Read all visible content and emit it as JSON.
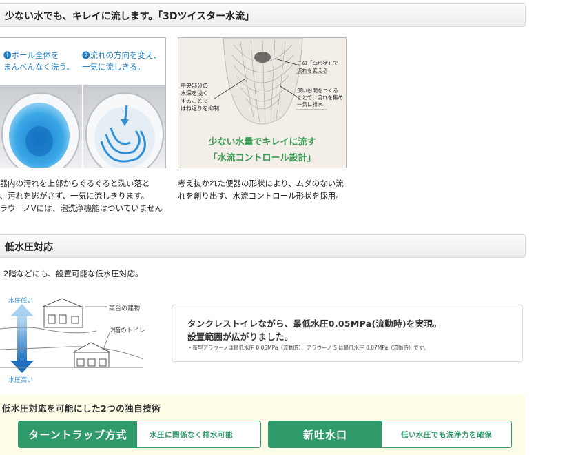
{
  "section1": {
    "header": "少ない水でも、キレイに流します。「3Dツイスター水流」",
    "photo1": {
      "step1": "❶ボール全体を\nまんべんなく洗う。",
      "step2": "❷流れの方向を変え、\n一気に流しきる。"
    },
    "photo2": {
      "label_left": "中央部分の\n水深を浅く\nすることで\nはね返りを抑制",
      "label_top_right": "この「凸形状」で\n流れを変える",
      "label_mid_right": "深い谷間をつくる\nことで、流れを集め\n一気に排水",
      "title_line1": "少ない水量でキレイに流す",
      "title_line2": "「水流コントロール設計」"
    },
    "caption1": "便器内の汚れを上部からぐるぐると洗い落とし、汚れを逃がさず、一気に流しきります。\nアラウーノVには、泡洗浄機能はついていません",
    "caption2": "考え抜かれた便器の形状により、ムダのない流れを創り出す、水流コントロール形状を採用。"
  },
  "section2": {
    "header": "低水圧対応",
    "intro": "2階などにも、設置可能な低水圧対応。",
    "diagram": {
      "low_pressure": "水圧低い",
      "high_pressure": "水圧高い",
      "tall_building": "高台の建物",
      "second_floor": "2階のトイレ"
    },
    "info": {
      "line1": "タンクレストイレながら、最低水圧0.05MPa(流動時)を実現。",
      "line2": "設置範囲が広がりました。",
      "note": "・新型アラウーノは最低水圧 0.05MPa（流動時）、アラウーノ S は最低水圧 0.07MPa（流動時）です。"
    }
  },
  "section3": {
    "title": "低水圧対応を可能にした2つの独自技術",
    "features": [
      {
        "name": "ターントラップ方式",
        "desc": "水圧に関係なく排水可能"
      },
      {
        "name": "新吐水口",
        "desc": "低い水圧でも洗浄力を確保"
      }
    ]
  },
  "colors": {
    "accent_green": "#2f9a6a",
    "water_blue": "#2a8fd8",
    "panel_yellow": "#fdfde8"
  }
}
